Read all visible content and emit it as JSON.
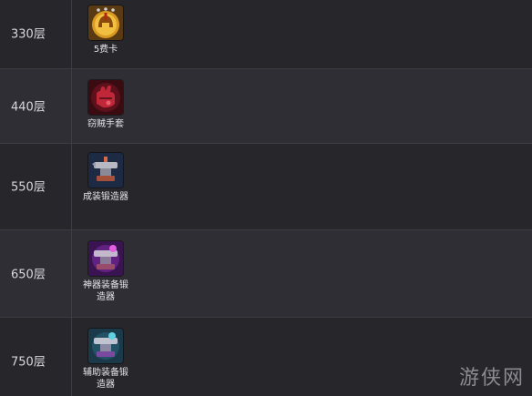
{
  "rows": [
    {
      "floor": "330层",
      "reward": "5费卡",
      "icon": "gold-spartan-helmet-icon"
    },
    {
      "floor": "440层",
      "reward": "窃贼手套",
      "icon": "thief-gloves-icon"
    },
    {
      "floor": "550层",
      "reward": "成装锻造器",
      "icon": "anvil-completed-item-icon"
    },
    {
      "floor": "650层",
      "reward": "神器装备锻造器",
      "icon": "anvil-artifact-icon"
    },
    {
      "floor": "750层",
      "reward": "辅助装备锻造器",
      "icon": "anvil-support-item-icon"
    }
  ],
  "watermark": "游侠网",
  "colors": {
    "row_dark": "#26262b",
    "row_light": "#2e2e34",
    "divider": "#3c3c44",
    "text": "#e6e6ea"
  }
}
